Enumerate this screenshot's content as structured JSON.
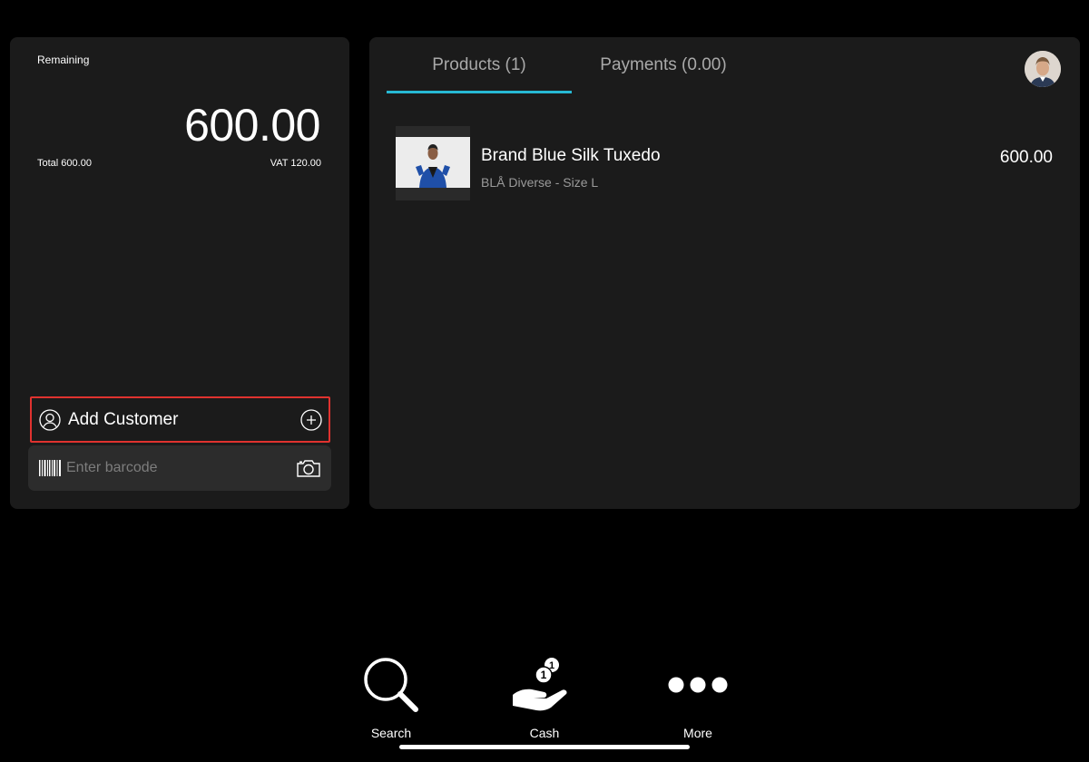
{
  "summary": {
    "remaining_label": "Remaining",
    "remaining_amount": "600.00",
    "total_text": "Total 600.00",
    "vat_text": "VAT 120.00"
  },
  "customer": {
    "add_label": "Add Customer",
    "user_icon": "user-icon",
    "add_icon": "plus-circle-icon"
  },
  "barcode": {
    "placeholder": "Enter barcode",
    "value": "",
    "barcode_icon": "barcode-icon",
    "camera_icon": "camera-icon"
  },
  "tabs": [
    {
      "label": "Products (1)",
      "active": true
    },
    {
      "label": "Payments (0.00)",
      "active": false
    }
  ],
  "products": [
    {
      "name": "Brand Blue Silk Tuxedo",
      "variant": "BLÅ Diverse - Size L",
      "price": "600.00"
    }
  ],
  "nav": {
    "search_label": "Search",
    "cash_label": "Cash",
    "more_label": "More"
  },
  "colors": {
    "accent": "#27b9d4",
    "highlight_border": "#e0322f",
    "panel_bg": "#1b1b1b",
    "background": "#000000"
  }
}
